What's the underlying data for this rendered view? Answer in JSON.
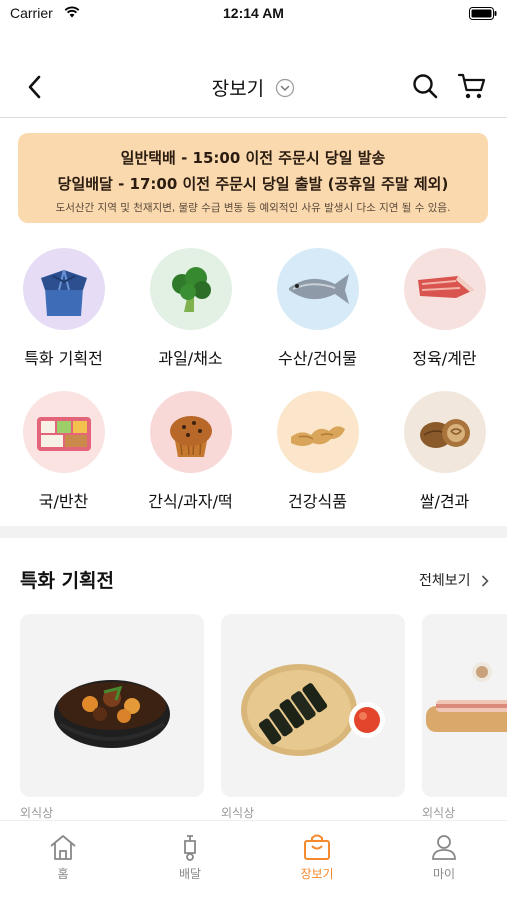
{
  "status_bar": {
    "carrier": "Carrier",
    "time": "12:14 AM"
  },
  "header": {
    "title": "장보기"
  },
  "notice": {
    "line1": "일반택배 - 15:00 이전 주문시 당일 발송",
    "line2": "당일배달 - 17:00 이전 주문시 당일 출발 (공휴일 주말 제외)",
    "line3": "도서산간 지역 및 천재지변, 물량 수급 변동 등 예외적인 사유 발생시 다소 지연 될 수 있음."
  },
  "categories": [
    {
      "label": "특화 기획전",
      "icon": "package-gift-icon",
      "bg": "#e6dcf6"
    },
    {
      "label": "과일/채소",
      "icon": "broccoli-icon",
      "bg": "#e3f0e4"
    },
    {
      "label": "수산/건어물",
      "icon": "fish-icon",
      "bg": "#d7eaf7"
    },
    {
      "label": "정육/계란",
      "icon": "meat-icon",
      "bg": "#f6e1df"
    },
    {
      "label": "국/반찬",
      "icon": "lunchbox-icon",
      "bg": "#fbe3e2"
    },
    {
      "label": "간식/과자/떡",
      "icon": "muffin-icon",
      "bg": "#f9d8d8"
    },
    {
      "label": "건강식품",
      "icon": "ginger-icon",
      "bg": "#fbe6cc"
    },
    {
      "label": "쌀/견과",
      "icon": "walnut-icon",
      "bg": "#f1e7dd"
    }
  ],
  "section": {
    "title": "특화 기획전",
    "see_all": "전체보기"
  },
  "products": [
    {
      "image": "braised-chicken-dish",
      "subtitle": "외식상"
    },
    {
      "image": "gimbap-platter",
      "subtitle": "외식상"
    },
    {
      "image": "pork-belly-board",
      "subtitle": "외식상"
    }
  ],
  "tabs": [
    {
      "label": "홈",
      "icon": "home-icon",
      "active": false
    },
    {
      "label": "배달",
      "icon": "scooter-icon",
      "active": false
    },
    {
      "label": "장보기",
      "icon": "shopping-bag-icon",
      "active": true
    },
    {
      "label": "마이",
      "icon": "person-icon",
      "active": false
    }
  ],
  "colors": {
    "accent": "#f5892e",
    "notice_bg": "#fbd9ae",
    "inactive_tab": "#888888"
  }
}
